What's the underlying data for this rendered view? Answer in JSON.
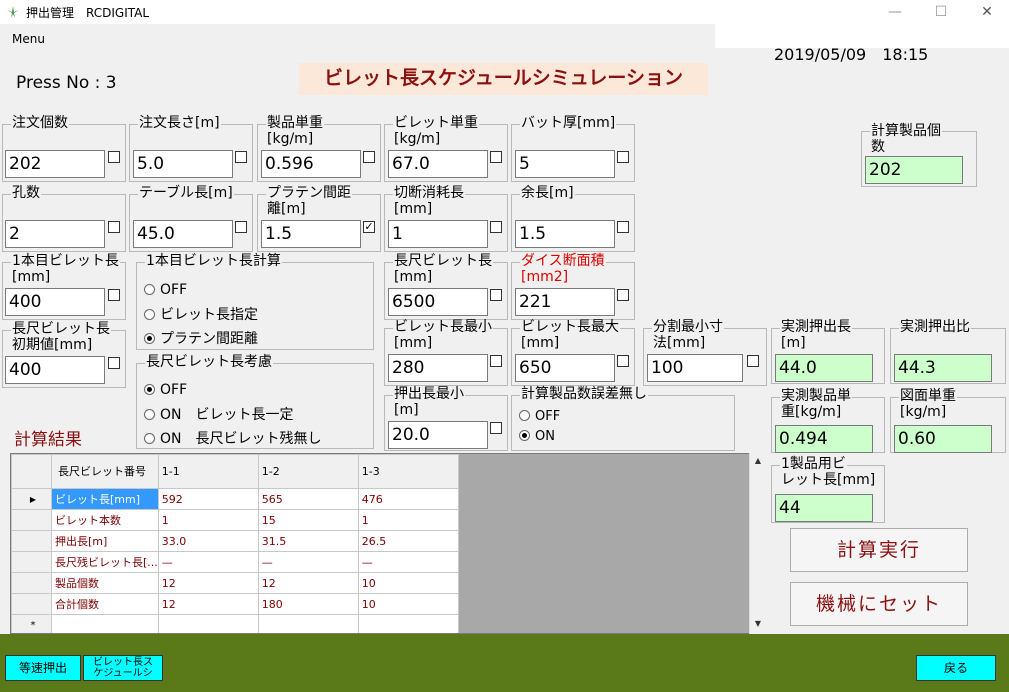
{
  "window": {
    "title": "押出管理　RCDIGITAL",
    "minimize": "—",
    "maximize": "☐",
    "close": "✕"
  },
  "menu": {
    "item": "Menu"
  },
  "header": {
    "datetime": "2019/05/09　18:15",
    "press": "Press No : 3",
    "banner": "ビレット長スケジュールシミュレーション"
  },
  "fields": {
    "order_qty": {
      "label": "注文個数",
      "value": "202"
    },
    "order_len": {
      "label": "注文長さ[m]",
      "value": "5.0"
    },
    "unit_weight": {
      "label1": "製品単重",
      "label2": "[kg/m]",
      "value": "0.596"
    },
    "billet_weight": {
      "label1": "ビレット単重",
      "label2": "[kg/m]",
      "value": "67.0"
    },
    "butt_thickness": {
      "label": "バット厚[mm]",
      "value": "5"
    },
    "calc_qty": {
      "label1": "計算製品個",
      "label2": "数",
      "value": "202"
    },
    "holes": {
      "label": "孔数",
      "value": "2"
    },
    "table_len": {
      "label": "テーブル長[m]",
      "value": "45.0"
    },
    "platen_dist": {
      "label1": "プラテン間距",
      "label2": "離[m]",
      "value": "1.5",
      "checked": "✓"
    },
    "cut_loss": {
      "label1": "切断消耗長",
      "label2": "[mm]",
      "value": "1"
    },
    "extra_len": {
      "label": "余長[m]",
      "value": "1.5"
    },
    "first_billet_len": {
      "label1": "1本目ビレット長",
      "label2": "[mm]",
      "value": "400"
    },
    "long_billet_len": {
      "label1": "長尺ビレット長",
      "label2": "[mm]",
      "value": "6500"
    },
    "die_area": {
      "label1": "ダイス断面積",
      "label2": "[mm2]",
      "value": "221"
    },
    "long_billet_init": {
      "label1": "長尺ビレット長",
      "label2": "初期値[mm]",
      "value": "400"
    },
    "billet_min": {
      "label1": "ビレット長最小",
      "label2": "[mm]",
      "value": "280"
    },
    "billet_max": {
      "label1": "ビレット長最大",
      "label2": "[mm]",
      "value": "650"
    },
    "split_min": {
      "label1": "分割最小寸",
      "label2": "法[mm]",
      "value": "100"
    },
    "measured_len": {
      "label1": "実測押出長",
      "label2": "[m]",
      "value": "44.0"
    },
    "measured_ratio": {
      "label": "実測押出比",
      "value": "44.3"
    },
    "extrude_min": {
      "label1": "押出長最小",
      "label2": "[m]",
      "value": "20.0"
    },
    "measured_weight": {
      "label1": "実測製品単",
      "label2": "重[kg/m]",
      "value": "0.494"
    },
    "drawing_weight": {
      "label1": "図面単重",
      "label2": "[kg/m]",
      "value": "0.60"
    },
    "billet_per_product": {
      "label1": "1製品用ビ",
      "label2": "レット長[mm]",
      "value": "44"
    }
  },
  "first_billet_calc": {
    "label": "1本目ビレット長計算",
    "options": [
      "OFF",
      "ビレット長指定",
      "プラテン間距離"
    ],
    "selected": 2
  },
  "long_billet_consider": {
    "label": "長尺ビレット長考慮",
    "options": [
      "OFF",
      "ON　ビレット長一定",
      "ON　長尺ビレット残無し"
    ],
    "selected": 0
  },
  "no_error": {
    "label": "計算製品数誤差無し",
    "options": [
      "OFF",
      "ON"
    ],
    "selected": 1
  },
  "result_label": "計算結果",
  "grid": {
    "header": [
      "長尺ビレット番号",
      "1-1",
      "1-2",
      "1-3"
    ],
    "row_marker": "▶",
    "new_marker": "*",
    "rows": [
      [
        "ビレット長[mm]",
        "592",
        "565",
        "476"
      ],
      [
        "ビレット本数",
        "1",
        "15",
        "1"
      ],
      [
        "押出長[m]",
        "33.0",
        "31.5",
        "26.5"
      ],
      [
        "長尺残ビレット長[...",
        "—",
        "—",
        "—"
      ],
      [
        "製品個数",
        "12",
        "12",
        "10"
      ],
      [
        "合計個数",
        "12",
        "180",
        "10"
      ]
    ]
  },
  "buttons": {
    "calc": "計算実行",
    "set_machine": "機械にセット"
  },
  "footer": {
    "constant_speed": "等速押出",
    "billet_schedule_1": "ビレット長ス",
    "billet_schedule_2": "ケジュールシ",
    "back": "戻る"
  }
}
